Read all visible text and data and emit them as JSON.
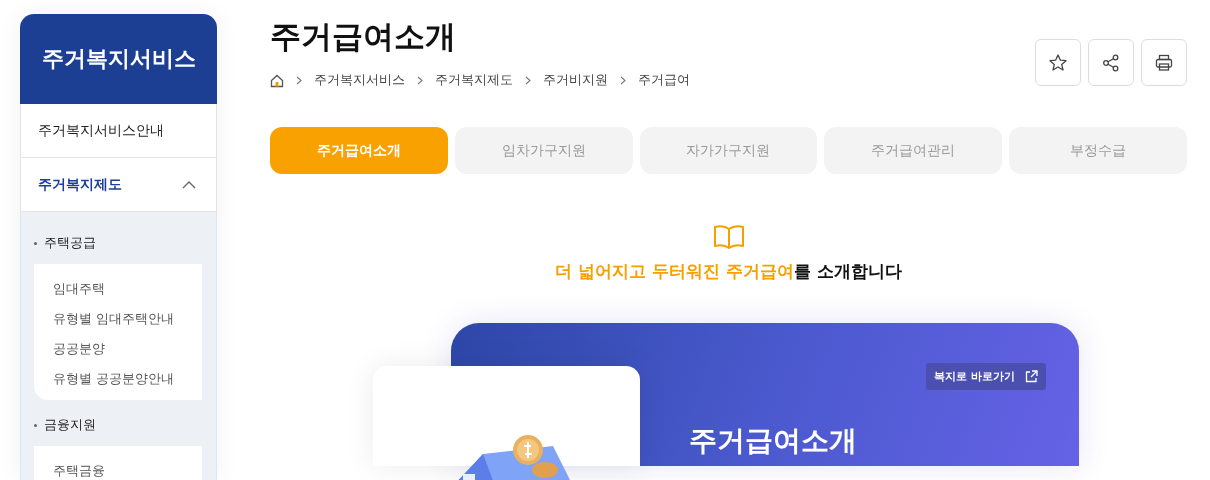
{
  "sidebar": {
    "title": "주거복지서비스",
    "items": [
      {
        "label": "주거복지서비스안내",
        "selected": false,
        "expanded": false
      },
      {
        "label": "주거복지제도",
        "selected": true,
        "expanded": true
      }
    ],
    "groups": [
      {
        "label": "주택공급",
        "links": [
          "임대주택",
          "유형별 임대주택안내",
          "공공분양",
          "유형별 공공분양안내"
        ]
      },
      {
        "label": "금융지원",
        "links": [
          "주택금융"
        ]
      }
    ]
  },
  "page": {
    "title": "주거급여소개",
    "breadcrumb": [
      "주거복지서비스",
      "주거복지제도",
      "주거비지원",
      "주거급여"
    ]
  },
  "tabs": [
    {
      "label": "주거급여소개",
      "selected": true
    },
    {
      "label": "임차가구지원",
      "selected": false
    },
    {
      "label": "자가가구지원",
      "selected": false
    },
    {
      "label": "주거급여관리",
      "selected": false
    },
    {
      "label": "부정수급",
      "selected": false
    }
  ],
  "intro": {
    "parts": [
      {
        "text": "더 넓어지고 두터워진 주거급여",
        "highlight": true
      },
      {
        "text": "를 소개합니다",
        "highlight": false
      }
    ]
  },
  "banner": {
    "link": "복지로 바로가기",
    "title": "주거급여소개"
  }
}
